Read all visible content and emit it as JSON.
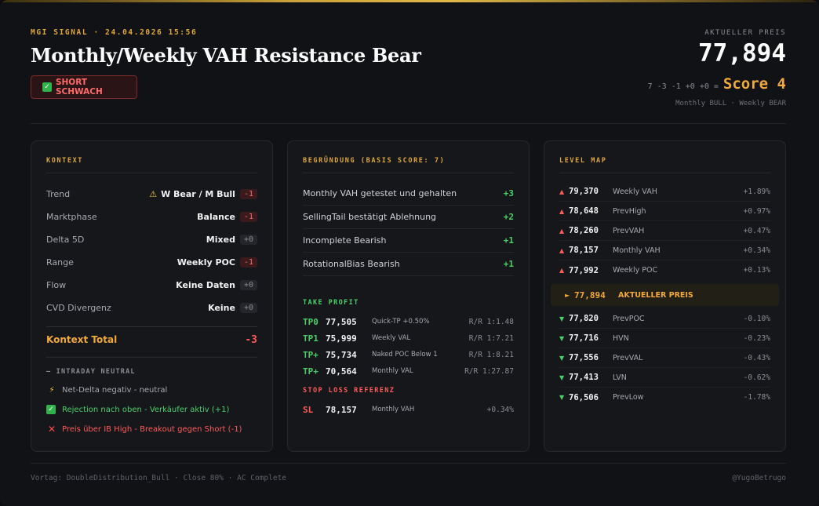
{
  "header": {
    "signal": "MGI SIGNAL · 24.04.2026 15:56",
    "title": "Monthly/Weekly VAH Resistance Bear",
    "badge": "SHORT SCHWACH",
    "badge_icon": "check-icon",
    "price_label": "AKTUELLER PREIS",
    "price": "77,894",
    "score_calc": "7 -3 -1 +0 +0 =",
    "score": "Score 4",
    "trend_sub": "Monthly BULL · Weekly BEAR"
  },
  "kontext": {
    "title": "KONTEXT",
    "rows": [
      {
        "label": "Trend",
        "value": "W Bear / M Bull",
        "pill": "-1",
        "warn": true
      },
      {
        "label": "Marktphase",
        "value": "Balance",
        "pill": "-1"
      },
      {
        "label": "Delta 5D",
        "value": "Mixed",
        "pill": "+0"
      },
      {
        "label": "Range",
        "value": "Weekly POC",
        "pill": "-1"
      },
      {
        "label": "Flow",
        "value": "Keine Daten",
        "pill": "+0"
      },
      {
        "label": "CVD Divergenz",
        "value": "Keine",
        "pill": "+0"
      }
    ],
    "total_label": "Kontext Total",
    "total_value": "-3",
    "intraday_title": "— INTRADAY NEUTRAL",
    "notes": [
      {
        "icon": "lightning-icon",
        "text": "Net-Delta negativ - neutral"
      },
      {
        "icon": "check-icon",
        "text": "Rejection nach oben - Verkäufer aktiv (+1)"
      },
      {
        "icon": "cross-icon",
        "text": "Preis über IB High - Breakout gegen Short (-1)"
      }
    ]
  },
  "begruendung": {
    "title": "BEGRÜNDUNG (BASIS SCORE: 7)",
    "rows": [
      {
        "label": "Monthly VAH getestet und gehalten",
        "value": "+3"
      },
      {
        "label": "SellingTail bestätigt Ablehnung",
        "value": "+2"
      },
      {
        "label": "Incomplete Bearish",
        "value": "+1"
      },
      {
        "label": "RotationalBias Bearish",
        "value": "+1"
      }
    ],
    "tp_title": "TAKE PROFIT",
    "tps": [
      {
        "tag": "TP0",
        "price": "77,505",
        "desc": "Quick-TP +0.50%",
        "rr": "R/R 1:1.48"
      },
      {
        "tag": "TP1",
        "price": "75,999",
        "desc": "Weekly VAL",
        "rr": "R/R 1:7.21"
      },
      {
        "tag": "TP+",
        "price": "75,734",
        "desc": "Naked POC Below 1",
        "rr": "R/R 1:8.21"
      },
      {
        "tag": "TP+",
        "price": "70,564",
        "desc": "Monthly VAL",
        "rr": "R/R 1:27.87"
      }
    ],
    "sl_title": "STOP LOSS REFERENZ",
    "sl": {
      "tag": "SL",
      "price": "78,157",
      "desc": "Monthly VAH",
      "rr": "+0.34%"
    }
  },
  "levelmap": {
    "title": "LEVEL MAP",
    "above": [
      {
        "price": "79,370",
        "name": "Weekly VAH",
        "pct": "+1.89%"
      },
      {
        "price": "78,648",
        "name": "PrevHigh",
        "pct": "+0.97%"
      },
      {
        "price": "78,260",
        "name": "PrevVAH",
        "pct": "+0.47%"
      },
      {
        "price": "78,157",
        "name": "Monthly VAH",
        "pct": "+0.34%"
      },
      {
        "price": "77,992",
        "name": "Weekly POC",
        "pct": "+0.13%"
      }
    ],
    "current": {
      "price": "77,894",
      "name": "AKTUELLER PREIS"
    },
    "below": [
      {
        "price": "77,820",
        "name": "PrevPOC",
        "pct": "-0.10%"
      },
      {
        "price": "77,716",
        "name": "HVN",
        "pct": "-0.23%"
      },
      {
        "price": "77,556",
        "name": "PrevVAL",
        "pct": "-0.43%"
      },
      {
        "price": "77,413",
        "name": "LVN",
        "pct": "-0.62%"
      },
      {
        "price": "76,506",
        "name": "PrevLow",
        "pct": "-1.78%"
      }
    ]
  },
  "footer": {
    "left": "Vortag: DoubleDistribution_Bull · Close 80% · AC Complete",
    "right": "@YugoBetrugo"
  },
  "colors": {
    "accent": "#e0a83a",
    "bear": "#ff5a5a",
    "bull": "#4ad06a",
    "background": "#111215",
    "panel": "#16171b"
  }
}
